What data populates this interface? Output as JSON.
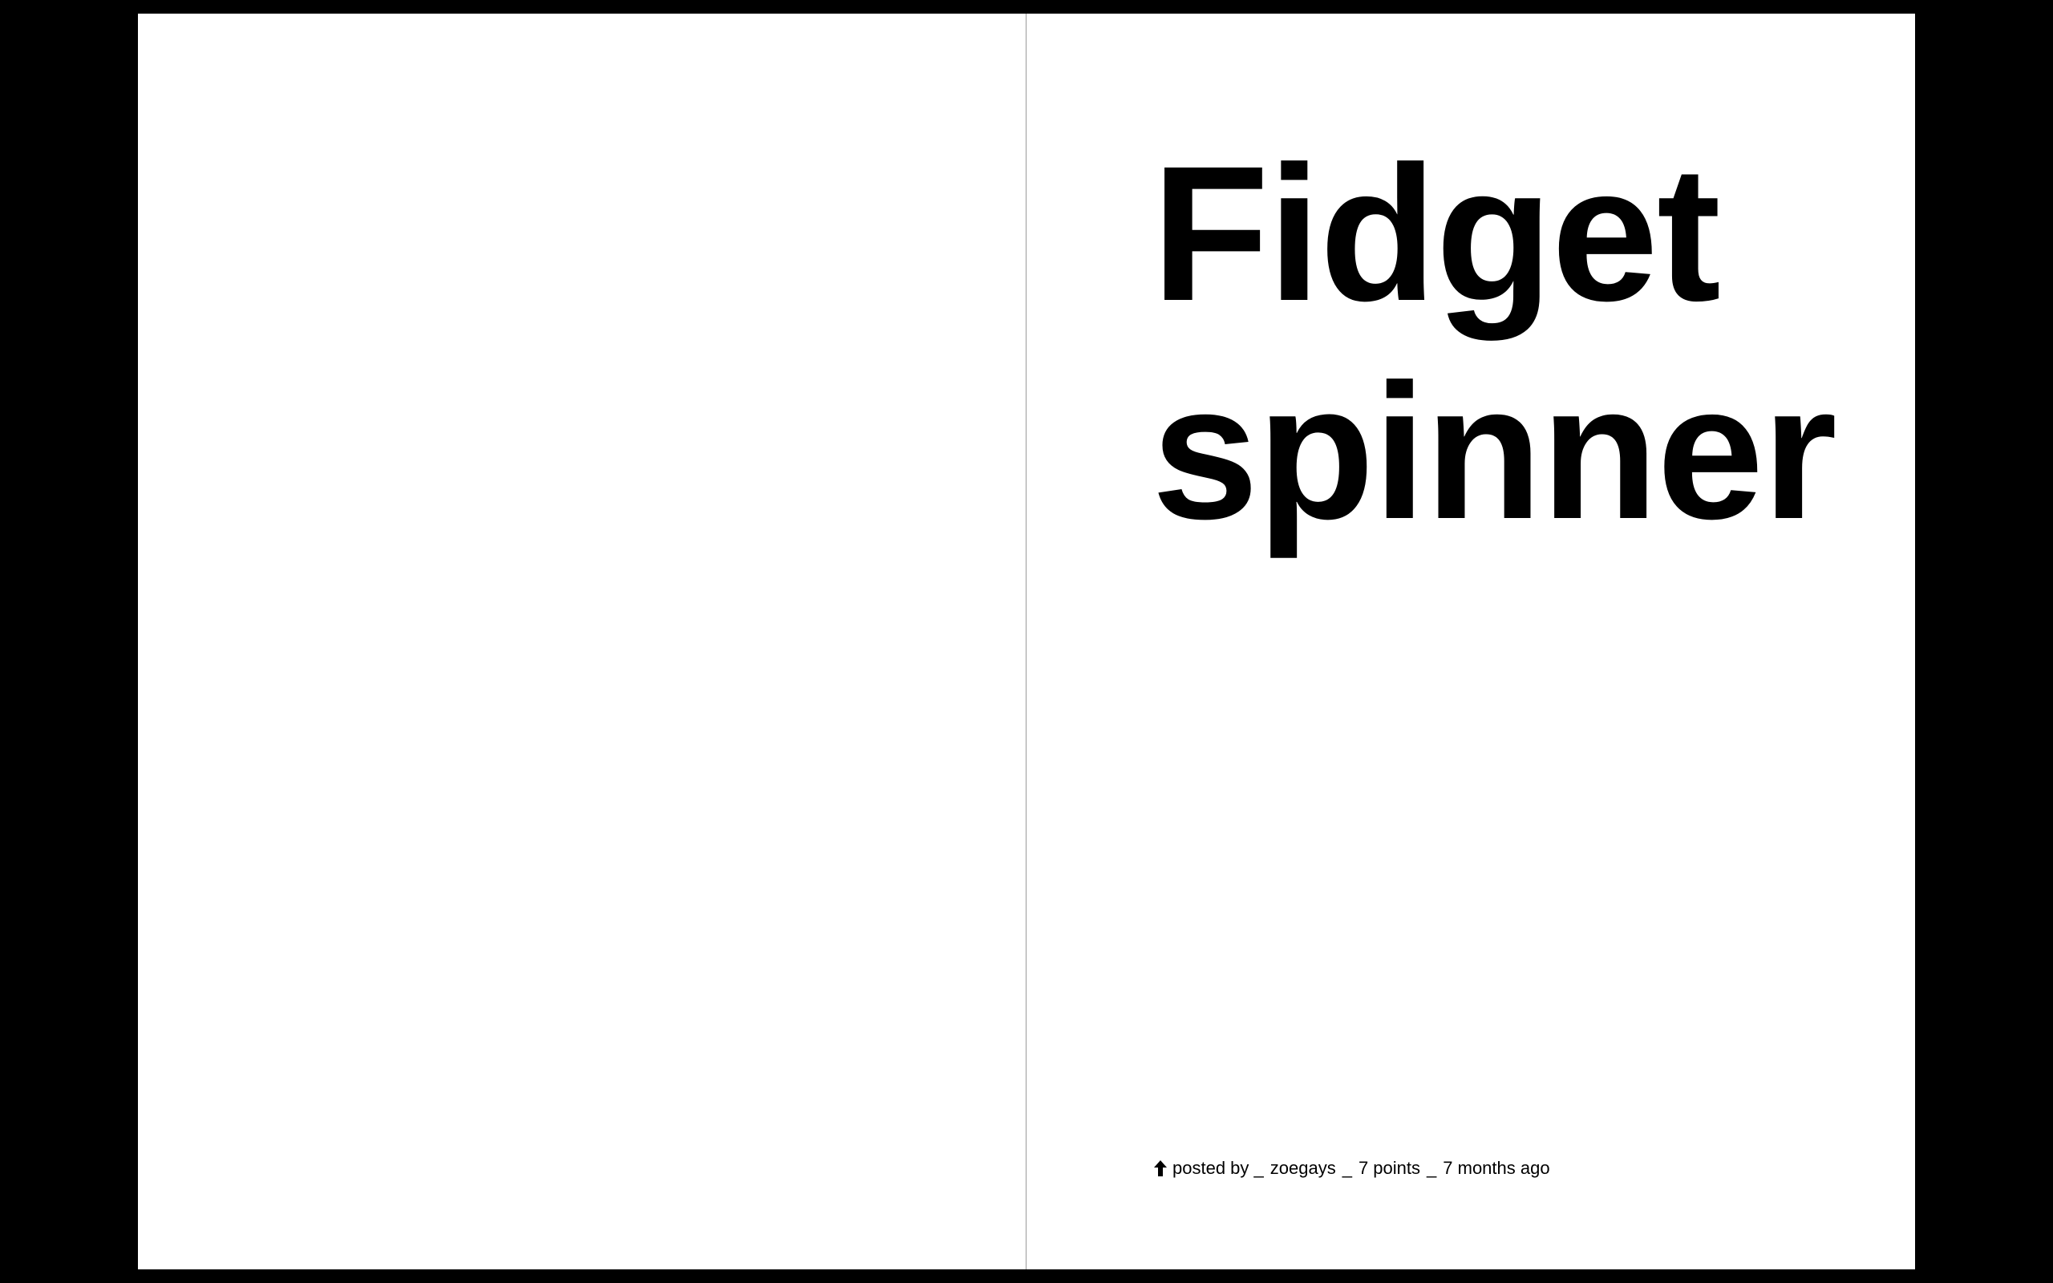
{
  "post": {
    "title_line1": "Fidget",
    "title_line2": "spinner",
    "upvote_icon": "arrow-up-icon",
    "posted_by_label": "posted by _",
    "author": "zoegays",
    "separator": "_",
    "points": "7 points",
    "age": "7 months ago"
  },
  "colors": {
    "background": "#000000",
    "page": "#ffffff",
    "text": "#000000",
    "divider": "#9a9a9a"
  }
}
